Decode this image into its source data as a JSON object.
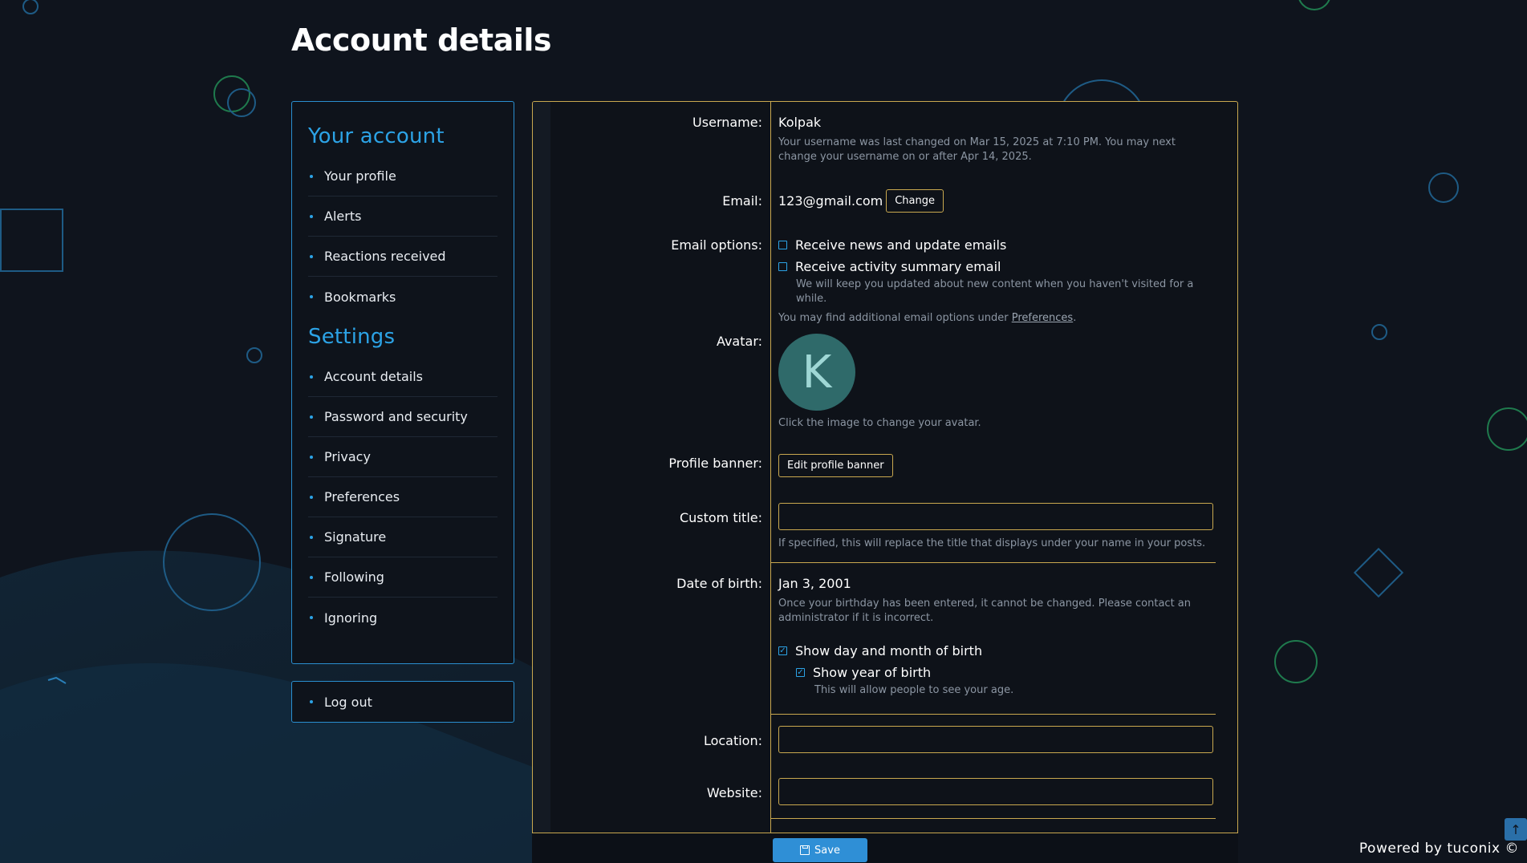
{
  "page": {
    "title": "Account details"
  },
  "sidebar": {
    "sections": [
      {
        "heading": "Your account",
        "items": [
          {
            "label": "Your profile"
          },
          {
            "label": "Alerts"
          },
          {
            "label": "Reactions received"
          },
          {
            "label": "Bookmarks"
          }
        ]
      },
      {
        "heading": "Settings",
        "items": [
          {
            "label": "Account details"
          },
          {
            "label": "Password and security"
          },
          {
            "label": "Privacy"
          },
          {
            "label": "Preferences"
          },
          {
            "label": "Signature"
          },
          {
            "label": "Following"
          },
          {
            "label": "Ignoring"
          }
        ]
      }
    ],
    "logout": "Log out"
  },
  "form": {
    "username": {
      "label": "Username:",
      "value": "Kolpak",
      "hint": "Your username was last changed on Mar 15, 2025 at 7:10 PM. You may next change your username on or after Apr 14, 2025."
    },
    "email": {
      "label": "Email:",
      "value": "123@gmail.com",
      "change_label": "Change"
    },
    "email_options": {
      "label": "Email options:",
      "news": "Receive news and update emails",
      "activity": "Receive activity summary email",
      "activity_hint": "We will keep you updated about new content when you haven't visited for a while.",
      "more_prefix": "You may find additional email options under ",
      "more_link": "Preferences",
      "more_suffix": "."
    },
    "avatar": {
      "label": "Avatar:",
      "letter": "K",
      "hint": "Click the image to change your avatar."
    },
    "banner": {
      "label": "Profile banner:",
      "button": "Edit profile banner"
    },
    "custom_title": {
      "label": "Custom title:",
      "value": "",
      "hint": "If specified, this will replace the title that displays under your name in your posts."
    },
    "dob": {
      "label": "Date of birth:",
      "value": "Jan 3, 2001",
      "hint": "Once your birthday has been entered, it cannot be changed. Please contact an administrator if it is incorrect.",
      "show_day_month": "Show day and month of birth",
      "show_year": "Show year of birth",
      "show_year_hint": "This will allow people to see your age."
    },
    "location": {
      "label": "Location:",
      "value": ""
    },
    "website": {
      "label": "Website:",
      "value": ""
    },
    "save_label": "Save"
  },
  "footer": {
    "powered": "Powered by tuconix ©"
  },
  "colors": {
    "accent": "#2ca3e6",
    "border_gold": "#c9a84f",
    "background": "#0f141d"
  }
}
